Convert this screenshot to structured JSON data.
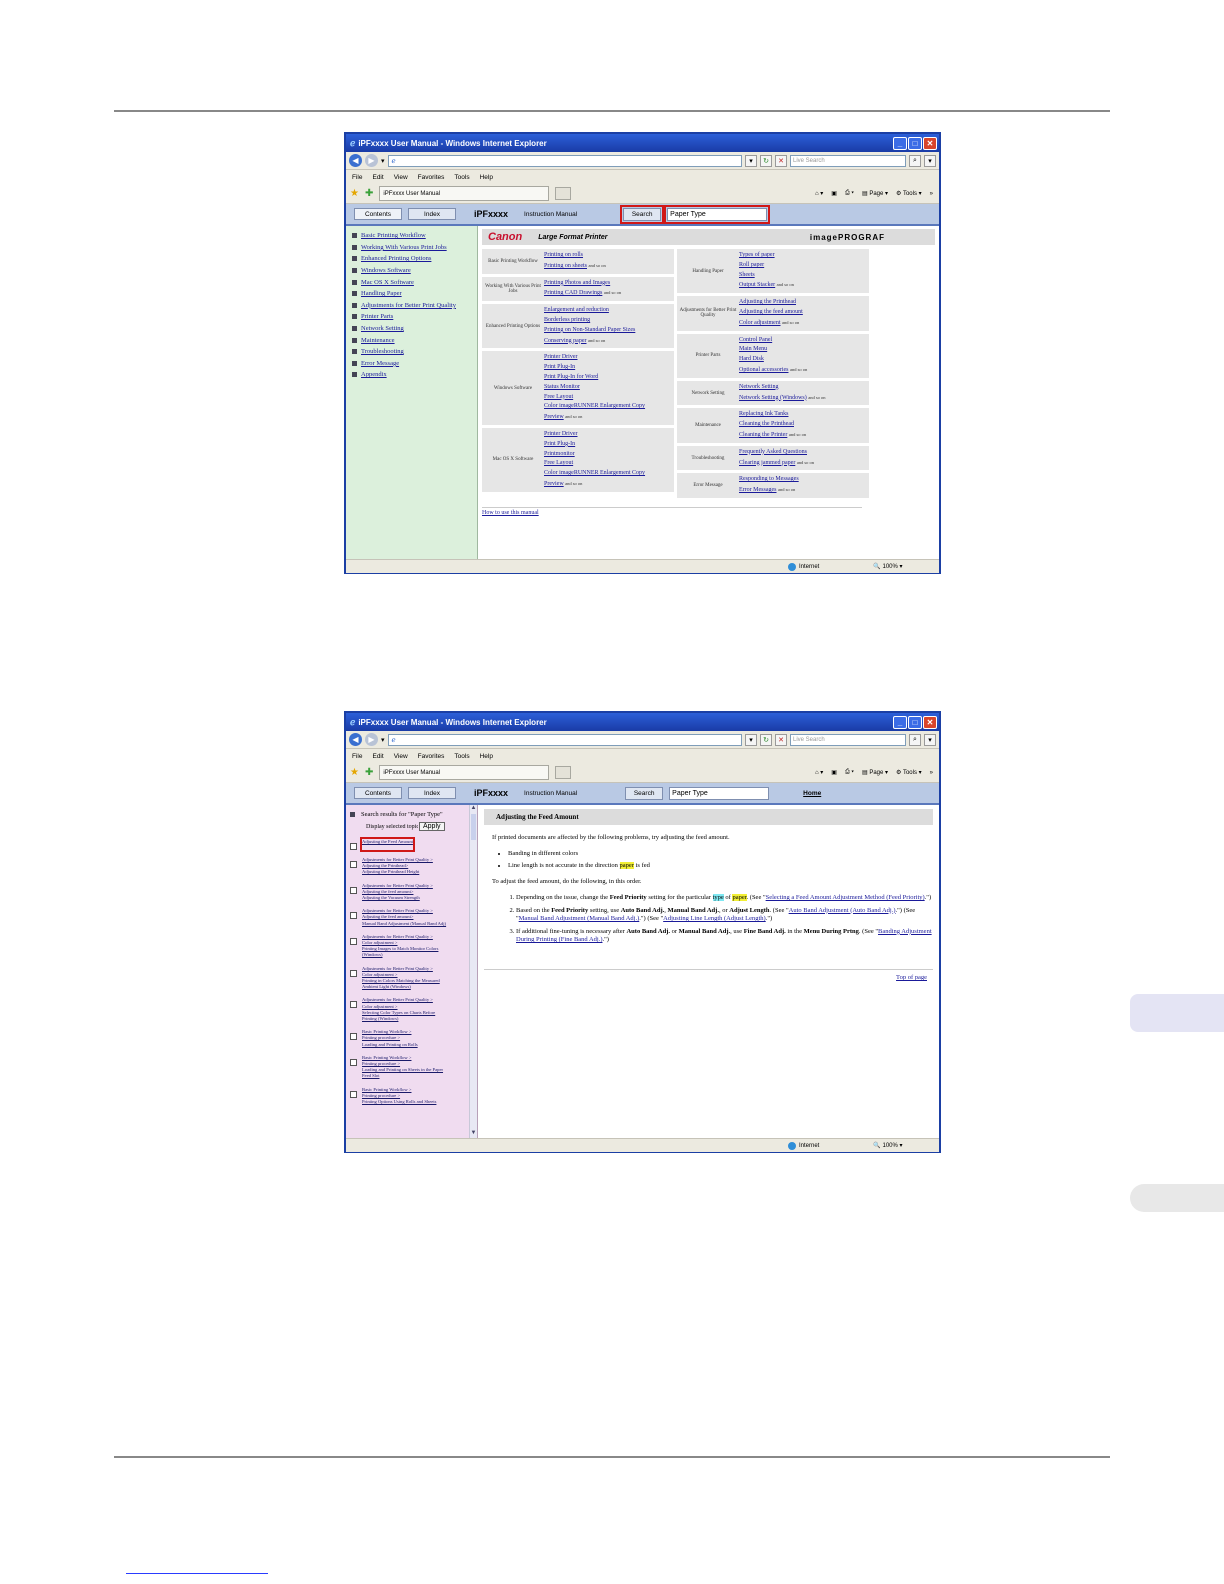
{
  "browser": {
    "title": "iPFxxxx User Manual - Windows Internet Explorer",
    "live_search_placeholder": "Live Search",
    "menu": [
      "File",
      "Edit",
      "View",
      "Favorites",
      "Tools",
      "Help"
    ],
    "tab_title": "iPFxxxx User Manual",
    "toolbar_page": "Page",
    "toolbar_tools": "Tools",
    "status_zone": "Internet",
    "zoom": "100%"
  },
  "nav": {
    "contents": "Contents",
    "index": "Index",
    "brand": "iPFxxxx",
    "manual": "Instruction Manual",
    "search_button": "Search",
    "search_value": "Paper Type",
    "home": "Home"
  },
  "screen1": {
    "left_items": [
      "Basic Printing Workflow",
      "Working With Various Print Jobs",
      "Enhanced Printing Options",
      "Windows Software",
      "Mac OS X Software",
      "Handling Paper",
      "Adjustments for Better Print Quality",
      "Printer Parts",
      "Network Setting",
      "Maintenance",
      "Troubleshooting",
      "Error Message",
      "Appendix"
    ],
    "banner": {
      "canon": "Canon",
      "tagline": "Large Format Printer",
      "product": "imagePROGRAF"
    },
    "left_categories": [
      {
        "name": "Basic Printing Workflow",
        "links": [
          "Printing on rolls",
          "Printing on sheets"
        ],
        "and_so_on": "and so on"
      },
      {
        "name": "Working With Various Print Jobs",
        "links": [
          "Printing Photos and Images",
          "Printing CAD Drawings"
        ],
        "and_so_on": "and so on"
      },
      {
        "name": "Enhanced Printing Options",
        "links": [
          "Enlargement and reduction",
          "Borderless printing",
          "Printing on Non-Standard Paper Sizes",
          "Conserving paper"
        ],
        "and_so_on": "and so on"
      },
      {
        "name": "Windows Software",
        "links": [
          "Printer Driver",
          "Print Plug-In",
          "Print Plug-In for Word",
          "Status Monitor",
          "Free Layout",
          "Color imageRUNNER Enlargement Copy",
          "Preview"
        ],
        "and_so_on": "and so on"
      },
      {
        "name": "Mac OS X Software",
        "links": [
          "Printer Driver",
          "Print Plug-In",
          "Printmonitor",
          "Free Layout",
          "Color imageRUNNER Enlargement Copy",
          "Preview"
        ],
        "and_so_on": "and so on"
      }
    ],
    "right_categories": [
      {
        "name": "Handling Paper",
        "links": [
          "Types of paper",
          "Roll paper",
          "Sheets",
          "Output Stacker"
        ],
        "and_so_on": "and so on"
      },
      {
        "name": "Adjustments for Better Print Quality",
        "links": [
          "Adjusting the Printhead",
          "Adjusting the feed amount",
          "Color adjustment"
        ],
        "and_so_on": "and so on"
      },
      {
        "name": "Printer Parts",
        "links": [
          "Control Panel",
          "Main Menu",
          "Hard Disk",
          "Optional accessories"
        ],
        "and_so_on": "and so on"
      },
      {
        "name": "Network Setting",
        "links": [
          "Network Setting",
          "Network Setting (Windows)"
        ],
        "and_so_on": "and so on"
      },
      {
        "name": "Maintenance",
        "links": [
          "Replacing Ink Tanks",
          "Cleaning the Printhead",
          "Cleaning the Printer"
        ],
        "and_so_on": "and so on"
      },
      {
        "name": "Troubleshooting",
        "links": [
          "Frequently Asked Questions",
          "Clearing jammed paper"
        ],
        "and_so_on": "and so on"
      },
      {
        "name": "Error Message",
        "links": [
          "Responding to Messages",
          "Error Messages"
        ],
        "and_so_on": "and so on"
      }
    ],
    "how_to": "How to use this manual"
  },
  "screen2": {
    "search_results_title": "Search results for \"Paper Type\"",
    "display_selected": "Display selected topics",
    "apply": "Apply",
    "results": [
      [
        "Adjusting the Feed Amount"
      ],
      [
        "Adjustments for Better Print Quality >",
        "Adjusting the Printhead>",
        "Adjusting the Printhead Height"
      ],
      [
        "Adjustments for Better Print Quality >",
        "Adjusting the feed amount>",
        "Adjusting the Vacuum Strength"
      ],
      [
        "Adjustments for Better Print Quality >",
        "Adjusting the feed amount>",
        "Manual Band Adjustment (Manual Band Adj)"
      ],
      [
        "Adjustments for Better Print Quality >",
        "Color adjustment >",
        "Printing Images to Match Monitor Colors",
        "(Windows)"
      ],
      [
        "Adjustments for Better Print Quality >",
        "Color adjustment >",
        "Printing in Colors Matching the Measured",
        "Ambient Light (Windows)"
      ],
      [
        "Adjustments for Better Print Quality >",
        "Color adjustment >",
        "Selecting Color Types on Charts Before",
        "Printing (Windows)"
      ],
      [
        "Basic Printing Workflow >",
        "Printing procedure >",
        "Loading and Printing on Rolls"
      ],
      [
        "Basic Printing Workflow >",
        "Printing procedure >",
        "Loading and Printing on Sheets in the Paper",
        "Feed Slot"
      ],
      [
        "Basic Printing Workflow >",
        "Printing procedure >",
        "Printing Options Using Rolls and Sheets"
      ]
    ],
    "article": {
      "title": "Adjusting the Feed Amount",
      "intro": "If printed documents are affected by the following problems, try adjusting the feed amount.",
      "bullet1": "Banding in different colors",
      "bullet2_pre": "Line length is not accurate in the direction ",
      "bullet2_hl": "paper",
      "bullet2_post": " is fed",
      "steps_intro": "To adjust the feed amount, do the following, in this order.",
      "step1_a": "Depending on the issue, change the ",
      "step1_b": "Feed Priority",
      "step1_c": " setting for the particular ",
      "step1_type": "type",
      "step1_of": " of ",
      "step1_paper": "paper",
      "step1_d": ". (See \"",
      "step1_link": "Selecting a Feed Amount Adjustment Method (Feed Priority)",
      "step1_e": ".\")",
      "step2_a": "Based on the ",
      "step2_b": "Feed Priority",
      "step2_c": " setting, use ",
      "step2_d": "Auto Band Adj.",
      "step2_e": ", ",
      "step2_f": "Manual Band Adj.",
      "step2_g": ", or ",
      "step2_h": "Adjust Length",
      "step2_i": ". (See \"",
      "step2_link1": "Auto Band Adjustment (Auto Band Adj.)",
      "step2_j": ".\") (See \"",
      "step2_link2": "Manual Band Adjustment (Manual Band Adj.)",
      "step2_k": ".\") (See \"",
      "step2_link3": "Adjusting Line Length (Adjust Length)",
      "step2_l": ".\")",
      "step3_a": "If additional fine-tuning is necessary after ",
      "step3_b": "Auto Band Adj.",
      "step3_c": " or ",
      "step3_d": "Manual Band Adj.",
      "step3_e": ", use ",
      "step3_f": "Fine Band Adj.",
      "step3_g": " in the ",
      "step3_h": "Menu During Prtng",
      "step3_i": ". (See \"",
      "step3_link": "Banding Adjustment During Printing (Fine Band Adj.)",
      "step3_j": ".\")",
      "top_of_page": "Top of page"
    }
  }
}
